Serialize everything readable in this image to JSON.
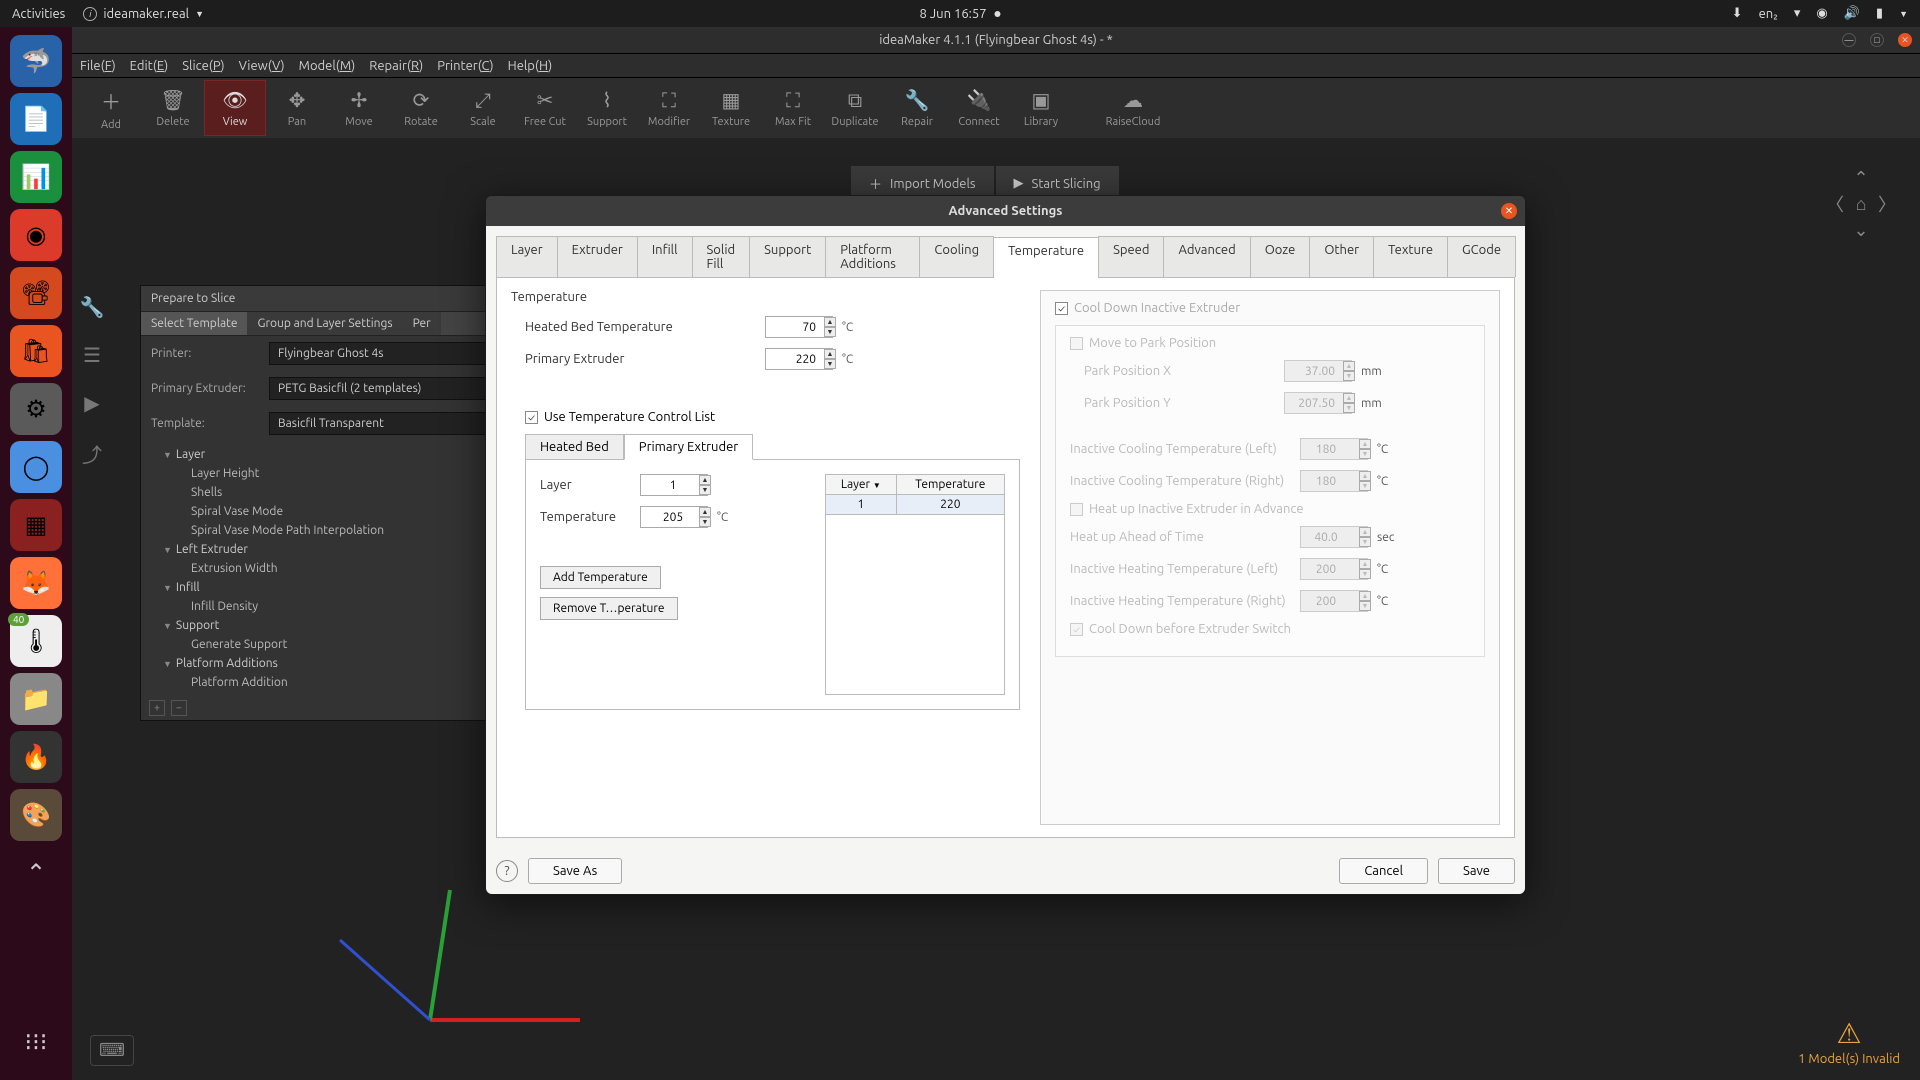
{
  "topbar": {
    "activities": "Activities",
    "app": "ideamaker.real",
    "datetime": "8 Jun  16:57",
    "lang": "en₂"
  },
  "titlebar": "ideaMaker 4.1.1 (Flyingbear Ghost 4s) - *",
  "menu": [
    "File(F)",
    "Edit(E)",
    "Slice(P)",
    "View(V)",
    "Model(M)",
    "Repair(R)",
    "Printer(C)",
    "Help(H)"
  ],
  "toolbar": [
    "Add",
    "Delete",
    "View",
    "Pan",
    "Move",
    "Rotate",
    "Scale",
    "Free Cut",
    "Support",
    "Modifier",
    "Texture",
    "Max Fit",
    "Duplicate",
    "Repair",
    "Connect",
    "Library",
    "RaiseCloud"
  ],
  "toolbar_icons": [
    "＋",
    "🗑",
    "👁",
    "✥",
    "✢",
    "⟳",
    "⤢",
    "✂",
    "⌇",
    "⛶",
    "▦",
    "⛶",
    "⧉",
    "🔧",
    "🔌",
    "▣",
    "☁"
  ],
  "quick": {
    "import": "Import Models",
    "slice": "Start Slicing"
  },
  "prepare": {
    "title": "Prepare to Slice",
    "tabs": [
      "Select Template",
      "Group and Layer Settings",
      "Per"
    ],
    "printer_label": "Printer:",
    "printer": "Flyingbear Ghost 4s",
    "extruder_label": "Primary Extruder:",
    "extruder": "PETG Basicfil (2 templates)",
    "template_label": "Template:",
    "template": "Basicfil Transparent",
    "tree": [
      {
        "label": "Layer",
        "children": [
          "Layer Height",
          "Shells",
          "Spiral Vase Mode",
          "Spiral Vase Mode Path Interpolation"
        ]
      },
      {
        "label": "Left Extruder",
        "children": [
          "Extrusion Width"
        ]
      },
      {
        "label": "Infill",
        "children": [
          "Infill Density"
        ]
      },
      {
        "label": "Support",
        "children": [
          "Generate Support"
        ]
      },
      {
        "label": "Platform Additions",
        "children": [
          "Platform Addition"
        ]
      }
    ]
  },
  "dialog": {
    "title": "Advanced Settings",
    "tabs": [
      "Layer",
      "Extruder",
      "Infill",
      "Solid Fill",
      "Support",
      "Platform Additions",
      "Cooling",
      "Temperature",
      "Speed",
      "Advanced",
      "Ooze",
      "Other",
      "Texture",
      "GCode"
    ],
    "active_tab": "Temperature",
    "section": "Temperature",
    "bed_label": "Heated Bed Temperature",
    "bed_value": "70",
    "primary_label": "Primary Extruder",
    "primary_value": "220",
    "unit_c": "°C",
    "use_temp_list": "Use Temperature Control List",
    "inner_tabs": [
      "Heated Bed",
      "Primary Extruder"
    ],
    "layer_label": "Layer",
    "layer_value": "1",
    "temp_label": "Temperature",
    "temp_value": "205",
    "add_temp": "Add Temperature",
    "remove_temp": "Remove T…perature",
    "table_h1": "Layer",
    "table_h2": "Temperature",
    "table_r1_c1": "1",
    "table_r1_c2": "220",
    "cool_down": "Cool Down Inactive Extruder",
    "move_park": "Move to Park Position",
    "park_x_label": "Park Position X",
    "park_x": "37.00",
    "park_y_label": "Park Position Y",
    "park_y": "207.50",
    "unit_mm": "mm",
    "inact_cool_l_label": "Inactive Cooling Temperature (Left)",
    "inact_cool_l": "180",
    "inact_cool_r_label": "Inactive Cooling Temperature (Right)",
    "inact_cool_r": "180",
    "heat_advance": "Heat up Inactive Extruder in Advance",
    "heat_ahead_label": "Heat up Ahead of Time",
    "heat_ahead": "40.0",
    "unit_sec": "sec",
    "inact_heat_l_label": "Inactive Heating Temperature (Left)",
    "inact_heat_l": "200",
    "inact_heat_r_label": "Inactive Heating Temperature (Right)",
    "inact_heat_r": "200",
    "cool_before": "Cool Down before Extruder Switch",
    "save_as": "Save As",
    "cancel": "Cancel",
    "save": "Save"
  },
  "warning": "1 Model(s) Invalid"
}
